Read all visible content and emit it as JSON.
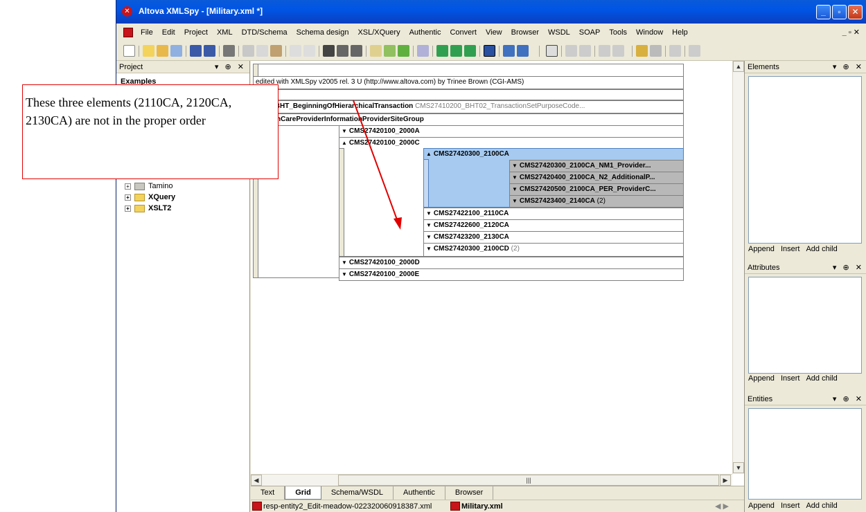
{
  "window": {
    "title": "Altova XMLSpy - [Military.xml *]",
    "min": "_",
    "max": "▫",
    "close": "✕"
  },
  "menu": {
    "items": [
      "File",
      "Edit",
      "Project",
      "XML",
      "DTD/Schema",
      "Schema design",
      "XSL/XQuery",
      "Authentic",
      "Convert",
      "View",
      "Browser",
      "WSDL",
      "SOAP",
      "Tools",
      "Window",
      "Help"
    ],
    "mdi_controls": "_ ▫ ✕"
  },
  "project": {
    "header": "Project",
    "header_controls": "▾ ⊕ ✕",
    "examples_label": "Examples",
    "folders": [
      {
        "label": "Tamino",
        "bold": false
      },
      {
        "label": "XQuery",
        "bold": true
      },
      {
        "label": "XSLT2",
        "bold": true
      }
    ]
  },
  "grid": {
    "comment": "edited with XMLSpy v2005 rel. 3 U (http://www.altova.com) by Trinee Brown (CGI-AMS)",
    "bht_element": "0200_BHT_BeginningOfHierarchicalTransaction",
    "bht_value": "CMS27410200_BHT02_TransactionSetPurposeCode...",
    "group_element": "_HealthCareProviderInformationProviderSiteGroup",
    "row_2000A": "CMS27420100_2000A",
    "row_2000C": "CMS27420100_2000C",
    "row_2100CA": "CMS27420300_2100CA",
    "sub_nm1": "CMS27420300_2100CA_NM1_Provider...",
    "sub_n2": "CMS27420400_2100CA_N2_AdditionalP...",
    "sub_per": "CMS27420500_2100CA_PER_ProviderC...",
    "sub_2140": "CMS27423400_2140CA",
    "sub_2140_count": "(2)",
    "row_2110": "CMS27422100_2110CA",
    "row_2120": "CMS27422600_2120CA",
    "row_2130": "CMS27423200_2130CA",
    "row_2100CD": "CMS27420300_2100CD",
    "row_2100CD_count": "(2)",
    "row_2000D": "CMS27420100_2000D",
    "row_2000E": "CMS27420100_2000E"
  },
  "tabs": [
    "Text",
    "Grid",
    "Schema/WSDL",
    "Authentic",
    "Browser"
  ],
  "active_tab": "Grid",
  "files": [
    "resp-entity2_Edit-meadow-022320060918387.xml",
    "Military.xml"
  ],
  "panels": {
    "elements": {
      "title": "Elements",
      "controls": "▾ ⊕ ✕",
      "buttons": [
        "Append",
        "Insert",
        "Add child"
      ]
    },
    "attributes": {
      "title": "Attributes",
      "controls": "▾ ⊕ ✕",
      "buttons": [
        "Append",
        "Insert",
        "Add child"
      ]
    },
    "entities": {
      "title": "Entities",
      "controls": "▾ ⊕ ✕",
      "buttons": [
        "Append",
        "Insert",
        "Add child"
      ]
    }
  },
  "annotation": {
    "text": "These three elements (2110CA, 2120CA, 2130CA) are not in the proper order",
    "color": "#e00000"
  },
  "colors": {
    "selection": "#a6caf0",
    "selection_dark": "#b8b8b8",
    "titlebar": "#0055e5"
  }
}
